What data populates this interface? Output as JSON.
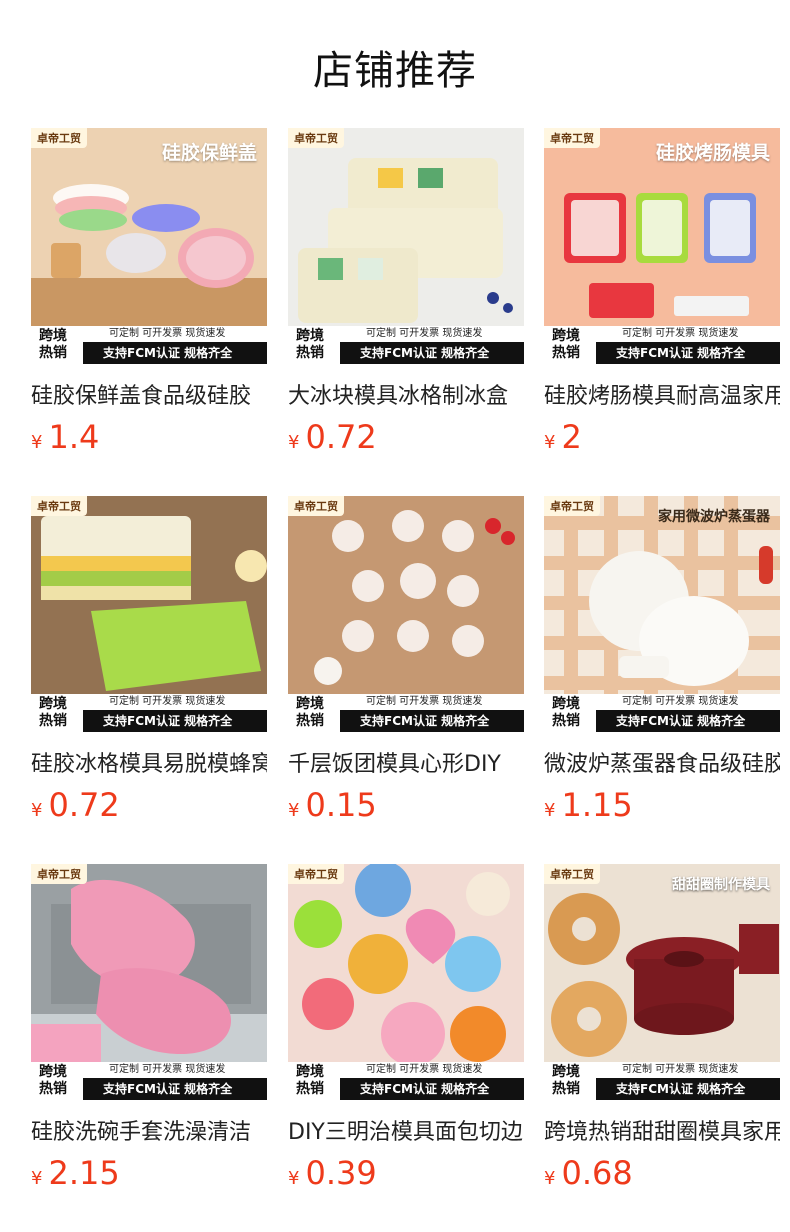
{
  "header": {
    "title": "店铺推荐"
  },
  "common_badges": {
    "store_tag": "卓帝工贸",
    "hot_line1": "跨境",
    "hot_line2": "热销",
    "service_text": "可定制 可开发票 现货速发",
    "cert_text": "支持FCM认证 规格齐全"
  },
  "products": [
    {
      "name": "硅胶保鲜盖食品级硅胶",
      "currency": "¥",
      "price": "1.4",
      "image_headline": "硅胶保鲜盖",
      "image_bg": "#e8c9a4"
    },
    {
      "name": "大冰块模具冰格制冰盒",
      "currency": "¥",
      "price": "0.72",
      "image_headline": "",
      "image_bg": "#ecebe6"
    },
    {
      "name": "硅胶烤肠模具耐高温家用",
      "currency": "¥",
      "price": "2",
      "image_headline": "硅胶烤肠模具",
      "image_bg": "#f4b89a"
    },
    {
      "name": "硅胶冰格模具易脱模蜂窝",
      "currency": "¥",
      "price": "0.72",
      "image_headline": "",
      "image_bg": "#8a6a4c"
    },
    {
      "name": "千层饭团模具心形DIY",
      "currency": "¥",
      "price": "0.15",
      "image_headline": "",
      "image_bg": "#c99a72"
    },
    {
      "name": "微波炉蒸蛋器食品级硅胶",
      "currency": "¥",
      "price": "1.15",
      "image_headline": "家用微波炉蒸蛋器",
      "image_bg": "#f3e7da"
    },
    {
      "name": "硅胶洗碗手套洗澡清洁",
      "currency": "¥",
      "price": "2.15",
      "image_headline": "",
      "image_bg": "#9ea4a6"
    },
    {
      "name": "DIY三明治模具面包切边",
      "currency": "¥",
      "price": "0.39",
      "image_headline": "",
      "image_bg": "#f1d9d2"
    },
    {
      "name": "跨境热销甜甜圈模具家用",
      "currency": "¥",
      "price": "0.68",
      "image_headline": "甜甜圈制作模具",
      "image_bg": "#e9dccd"
    }
  ]
}
